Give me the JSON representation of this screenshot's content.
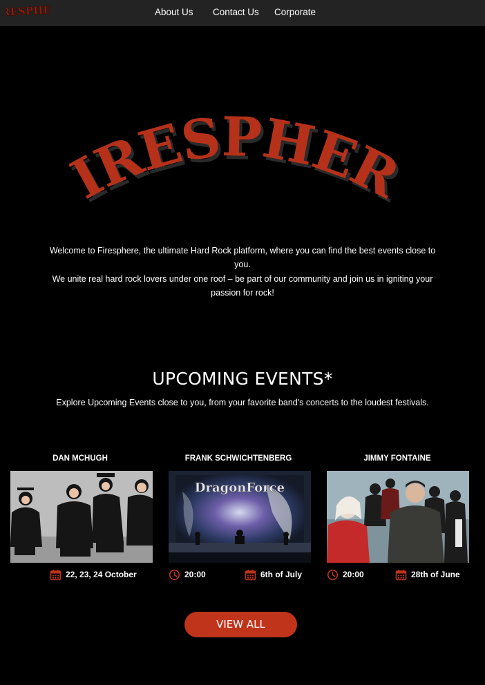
{
  "brand": {
    "name": "Firesphere",
    "accent": "#c0341b",
    "logo_text": "FIRESPHERE"
  },
  "nav": {
    "about": "About Us",
    "contact": "Contact Us",
    "corporate": "Corporate"
  },
  "intro": {
    "line1": "Welcome to Firesphere, the ultimate Hard Rock platform, where you can find the best events close to you.",
    "line2": "We unite real hard rock lovers under one roof – be part of our community and join us in igniting your passion for rock!"
  },
  "events": {
    "title": "UPCOMING EVENTS*",
    "subtitle": "Explore Upcoming Events close to you, from your favorite band's concerts to the loudest festivals.",
    "cards": [
      {
        "name": "DAN MCHUGH",
        "date": "22, 23, 24 October",
        "image": "band-photo"
      },
      {
        "name": "FRANK SCHWICHTENBERG",
        "time": "20:00",
        "date": "6th of July",
        "image": "dragonforce-stage-photo",
        "image_text": "DragonForce"
      },
      {
        "name": "JIMMY FONTAINE",
        "time": "20:00",
        "date": "28th of June",
        "image": "linkin-park-photo"
      }
    ]
  },
  "cta": {
    "view_all": "VIEW ALL"
  },
  "icons": {
    "clock": "clock-icon",
    "calendar": "calendar-icon"
  }
}
